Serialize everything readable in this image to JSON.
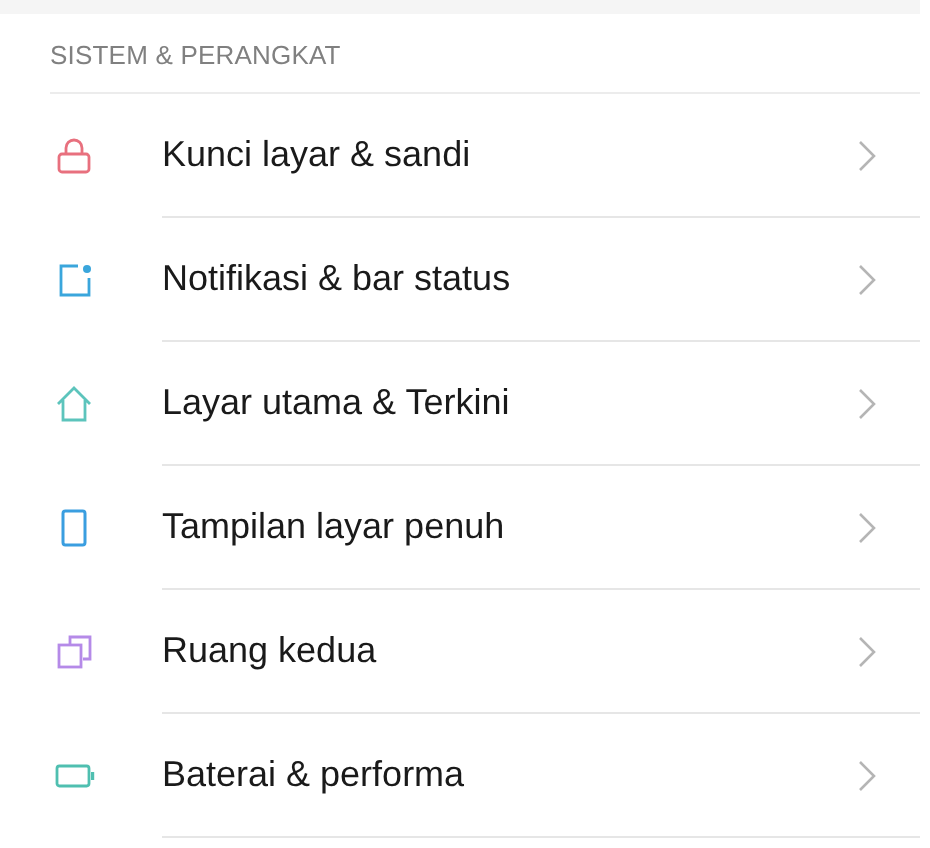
{
  "section": {
    "title": "SISTEM & PERANGKAT"
  },
  "items": [
    {
      "label": "Kunci layar & sandi",
      "color": "#e8707e"
    },
    {
      "label": "Notifikasi & bar status",
      "color": "#3aa6dc"
    },
    {
      "label": "Layar utama & Terkini",
      "color": "#5cc4bc"
    },
    {
      "label": "Tampilan layar penuh",
      "color": "#3a9ee0"
    },
    {
      "label": "Ruang kedua",
      "color": "#b58ae8"
    },
    {
      "label": "Baterai & performa",
      "color": "#4fbfb0"
    }
  ]
}
